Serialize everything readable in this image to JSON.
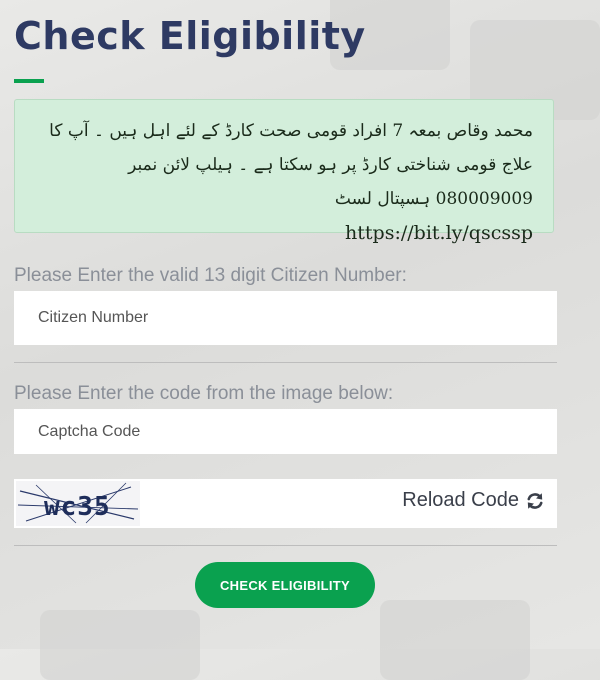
{
  "page": {
    "title": "Check Eligibility"
  },
  "notice": {
    "urdu_text": "محمد وقاص بمعہ 7 افراد قومی صحت کارڈ کے لئے اہل ہیں ۔ آپ کا علاج قومی شناختی کارڈ پر ہو سکتا ہے ۔ ہیلپ لائن نمبر 080009009 ہسپتال لسٹ",
    "link": "https://bit.ly/qscssp"
  },
  "citizen": {
    "label": "Please Enter the valid 13 digit Citizen Number:",
    "placeholder": "Citizen Number",
    "value": ""
  },
  "captcha": {
    "label": "Please Enter the code from the image below:",
    "placeholder": "Captcha Code",
    "value": "",
    "image_text": "wc35",
    "reload_label": "Reload Code",
    "reload_icon": "refresh-icon"
  },
  "submit": {
    "label": "CHECK ELIGIBILITY"
  },
  "colors": {
    "accent": "#0aa14f",
    "title": "#2e3a63",
    "notice_bg": "#d3eedb"
  }
}
